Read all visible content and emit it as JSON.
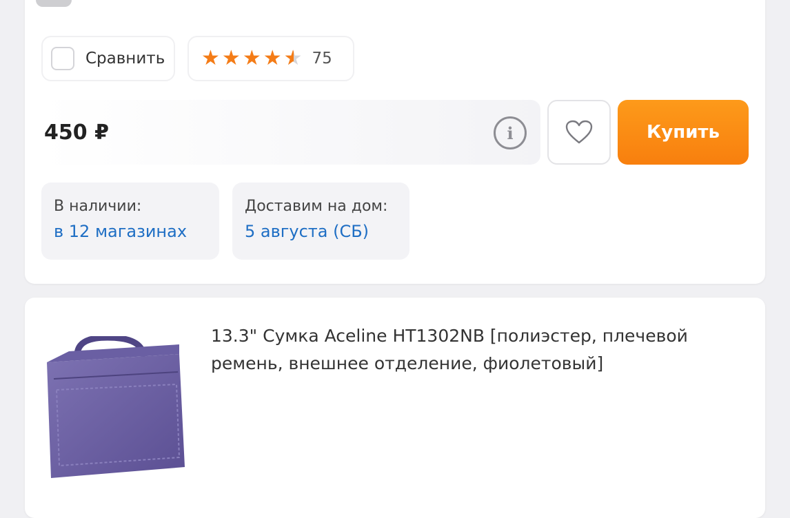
{
  "compare": {
    "label": "Сравнить"
  },
  "rating": {
    "value": 4.5,
    "max": 5,
    "count": "75"
  },
  "price": {
    "amount": "450 ₽"
  },
  "buy_button": {
    "label": "Купить"
  },
  "availability": {
    "stock_label": "В наличии:",
    "stock_link": "в 12 магазинах",
    "delivery_label": "Доставим на дом:",
    "delivery_link": "5 августа (СБ)"
  },
  "product": {
    "title": "13.3\" Сумка Aceline HT1302NB [полиэстер, плечевой ремень, внешнее отделение, фиолетовый]"
  },
  "colors": {
    "accent": "#f87f0e",
    "link": "#1e6ec4",
    "star": "#f47c17"
  }
}
